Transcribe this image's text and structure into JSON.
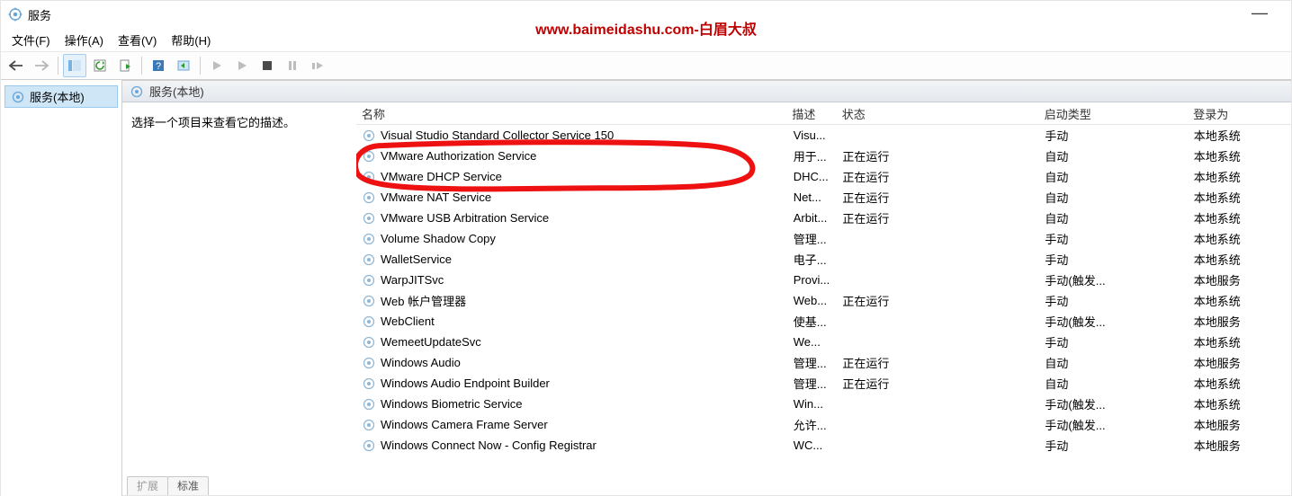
{
  "watermark": "www.baimeidashu.com-白眉大叔",
  "titlebar": {
    "title": "服务",
    "minimize": "—"
  },
  "menubar": [
    "文件(F)",
    "操作(A)",
    "查看(V)",
    "帮助(H)"
  ],
  "toolbar_icons": [
    "back-icon",
    "forward-icon",
    "sep",
    "show-hide-tree-icon",
    "refresh-icon",
    "export-list-icon",
    "sep",
    "help-icon",
    "properties-icon",
    "sep",
    "start-icon",
    "stop-glyph-icon",
    "stop-icon",
    "pause-icon",
    "restart-icon"
  ],
  "sidebar": {
    "root": "服务(本地)"
  },
  "panel": {
    "header": "服务(本地)",
    "hint": "选择一个项目来查看它的描述。",
    "columns": {
      "name": "名称",
      "desc": "描述",
      "status": "状态",
      "start": "启动类型",
      "logon": "登录为"
    }
  },
  "rows": [
    {
      "name": "Visual Studio Standard Collector Service 150",
      "desc": "Visu...",
      "status": "",
      "start": "手动",
      "logon": "本地系统"
    },
    {
      "name": "VMware Authorization Service",
      "desc": "用于...",
      "status": "正在运行",
      "start": "自动",
      "logon": "本地系统"
    },
    {
      "name": "VMware DHCP Service",
      "desc": "DHC...",
      "status": "正在运行",
      "start": "自动",
      "logon": "本地系统"
    },
    {
      "name": "VMware NAT Service",
      "desc": "Net...",
      "status": "正在运行",
      "start": "自动",
      "logon": "本地系统"
    },
    {
      "name": "VMware USB Arbitration Service",
      "desc": "Arbit...",
      "status": "正在运行",
      "start": "自动",
      "logon": "本地系统"
    },
    {
      "name": "Volume Shadow Copy",
      "desc": "管理...",
      "status": "",
      "start": "手动",
      "logon": "本地系统"
    },
    {
      "name": "WalletService",
      "desc": "电子...",
      "status": "",
      "start": "手动",
      "logon": "本地系统"
    },
    {
      "name": "WarpJITSvc",
      "desc": "Provi...",
      "status": "",
      "start": "手动(触发...",
      "logon": "本地服务"
    },
    {
      "name": "Web 帐户管理器",
      "desc": "Web...",
      "status": "正在运行",
      "start": "手动",
      "logon": "本地系统"
    },
    {
      "name": "WebClient",
      "desc": "使基...",
      "status": "",
      "start": "手动(触发...",
      "logon": "本地服务"
    },
    {
      "name": "WemeetUpdateSvc",
      "desc": "We...",
      "status": "",
      "start": "手动",
      "logon": "本地系统"
    },
    {
      "name": "Windows Audio",
      "desc": "管理...",
      "status": "正在运行",
      "start": "自动",
      "logon": "本地服务"
    },
    {
      "name": "Windows Audio Endpoint Builder",
      "desc": "管理...",
      "status": "正在运行",
      "start": "自动",
      "logon": "本地系统"
    },
    {
      "name": "Windows Biometric Service",
      "desc": "Win...",
      "status": "",
      "start": "手动(触发...",
      "logon": "本地系统"
    },
    {
      "name": "Windows Camera Frame Server",
      "desc": "允许...",
      "status": "",
      "start": "手动(触发...",
      "logon": "本地服务"
    },
    {
      "name": "Windows Connect Now - Config Registrar",
      "desc": "WC...",
      "status": "",
      "start": "手动",
      "logon": "本地服务"
    }
  ],
  "tabs": {
    "extended": "扩展",
    "standard": "标准"
  }
}
